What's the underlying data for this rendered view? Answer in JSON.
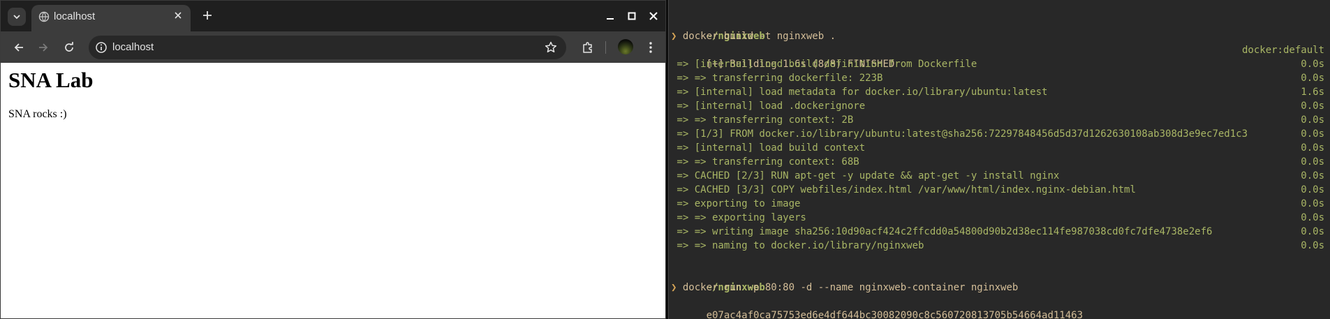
{
  "browser": {
    "tab": {
      "title": "localhost"
    },
    "omnibox": {
      "url": "localhost"
    },
    "page": {
      "heading": "SNA Lab",
      "text": "SNA rocks :)"
    }
  },
  "terminal": {
    "prompt1": {
      "dir": "~/nginxweb",
      "arrow": "❯",
      "command": "docker build -t nginxweb ."
    },
    "build_header": {
      "text": "[+] Building 1.6s (8/8) FINISHED",
      "right": "docker:default"
    },
    "steps": [
      {
        "text": " => [internal] load build definition from Dockerfile",
        "time": "0.0s"
      },
      {
        "text": " => => transferring dockerfile: 223B",
        "time": "0.0s"
      },
      {
        "text": " => [internal] load metadata for docker.io/library/ubuntu:latest",
        "time": "1.6s"
      },
      {
        "text": " => [internal] load .dockerignore",
        "time": "0.0s"
      },
      {
        "text": " => => transferring context: 2B",
        "time": "0.0s"
      },
      {
        "text": " => [1/3] FROM docker.io/library/ubuntu:latest@sha256:72297848456d5d37d1262630108ab308d3e9ec7ed1c3",
        "time": "0.0s"
      },
      {
        "text": " => [internal] load build context",
        "time": "0.0s"
      },
      {
        "text": " => => transferring context: 68B",
        "time": "0.0s"
      },
      {
        "text": " => CACHED [2/3] RUN apt-get -y update && apt-get -y install nginx",
        "time": "0.0s"
      },
      {
        "text": " => CACHED [3/3] COPY webfiles/index.html /var/www/html/index.nginx-debian.html",
        "time": "0.0s"
      },
      {
        "text": " => exporting to image",
        "time": "0.0s"
      },
      {
        "text": " => => exporting layers",
        "time": "0.0s"
      },
      {
        "text": " => => writing image sha256:10d90acf424c2ffcdd0a54800d90b2d38ec114fe987038cd0fc7dfe4738e2ef6",
        "time": "0.0s"
      },
      {
        "text": " => => naming to docker.io/library/nginxweb",
        "time": "0.0s"
      }
    ],
    "prompt2": {
      "dir": "~/nginxweb",
      "arrow": "❯",
      "command": "docker run -p 80:80 -d --name nginxweb-container nginxweb"
    },
    "container_id": "e07ac4af0ca75753ed6e4df644bc30082090c8c560720813705b54664ad11463"
  },
  "colors": {
    "terminal_bg": "#282828",
    "terminal_green": "#a9b665",
    "terminal_fg": "#d4be98",
    "prompt_arrow": "#d8a657",
    "browser_chrome": "#3c3c3c"
  }
}
